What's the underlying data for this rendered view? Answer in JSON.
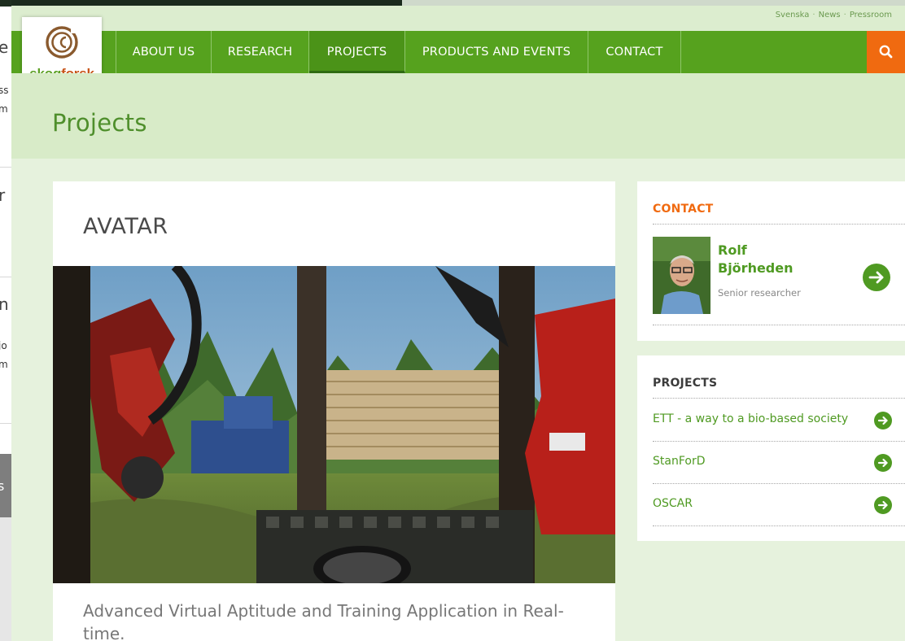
{
  "background_window": {
    "fragments": [
      "e",
      "ss",
      "m",
      "r",
      "n",
      "jo",
      "m",
      "s"
    ]
  },
  "top_links": [
    "Svenska",
    "News",
    "Pressroom"
  ],
  "logo": {
    "brand_prefix": "skog",
    "brand_suffix": "forsk"
  },
  "nav": {
    "items": [
      "ABOUT US",
      "RESEARCH",
      "PROJECTS",
      "PRODUCTS AND EVENTS",
      "CONTACT"
    ],
    "active": "PROJECTS"
  },
  "search_icon": "magnifier-icon",
  "page_title": "Projects",
  "project": {
    "title": "AVATAR",
    "intro": "Advanced Virtual Aptitude and Training Application in Real-time."
  },
  "contact": {
    "heading": "CONTACT",
    "name": "Rolf Björheden",
    "role": "Senior researcher"
  },
  "projects": {
    "heading": "PROJECTS",
    "items": [
      "ETT - a way to a bio-based society",
      "StanForD",
      "OSCAR"
    ]
  },
  "colors": {
    "brand_green": "#56a21e",
    "accent_orange": "#f06a10",
    "link_green": "#4f9a22",
    "page_bg": "#e6f2dd"
  }
}
